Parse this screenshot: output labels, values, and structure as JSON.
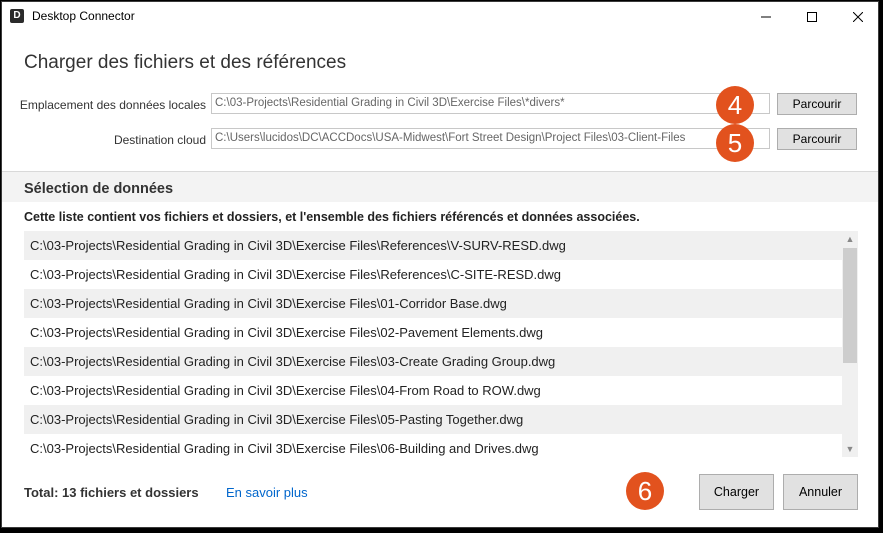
{
  "window": {
    "title": "Desktop Connector",
    "app_icon_letter": "D"
  },
  "page": {
    "title": "Charger des fichiers et des références"
  },
  "local": {
    "label": "Emplacement des données locales",
    "value": "C:\\03-Projects\\Residential Grading in Civil 3D\\Exercise Files\\*divers*",
    "browse_label": "Parcourir",
    "callout": "4"
  },
  "cloud": {
    "label": "Destination cloud",
    "value": "C:\\Users\\lucidos\\DC\\ACCDocs\\USA-Midwest\\Fort Street Design\\Project Files\\03-Client-Files",
    "browse_label": "Parcourir",
    "callout": "5"
  },
  "selection": {
    "title": "Sélection de données",
    "description": "Cette liste contient vos fichiers et dossiers, et l'ensemble des fichiers référencés et données associées.",
    "files": [
      "C:\\03-Projects\\Residential Grading in Civil 3D\\Exercise Files\\References\\V-SURV-RESD.dwg",
      "C:\\03-Projects\\Residential Grading in Civil 3D\\Exercise Files\\References\\C-SITE-RESD.dwg",
      "C:\\03-Projects\\Residential Grading in Civil 3D\\Exercise Files\\01-Corridor Base.dwg",
      "C:\\03-Projects\\Residential Grading in Civil 3D\\Exercise Files\\02-Pavement Elements.dwg",
      "C:\\03-Projects\\Residential Grading in Civil 3D\\Exercise Files\\03-Create Grading Group.dwg",
      "C:\\03-Projects\\Residential Grading in Civil 3D\\Exercise Files\\04-From Road to ROW.dwg",
      "C:\\03-Projects\\Residential Grading in Civil 3D\\Exercise Files\\05-Pasting Together.dwg",
      "C:\\03-Projects\\Residential Grading in Civil 3D\\Exercise Files\\06-Building and Drives.dwg"
    ]
  },
  "footer": {
    "total": "Total: 13 fichiers et dossiers",
    "learn_more": "En savoir plus",
    "upload_label": "Charger",
    "cancel_label": "Annuler",
    "callout": "6"
  },
  "colors": {
    "callout": "#e2521e",
    "link": "#0066cc"
  }
}
